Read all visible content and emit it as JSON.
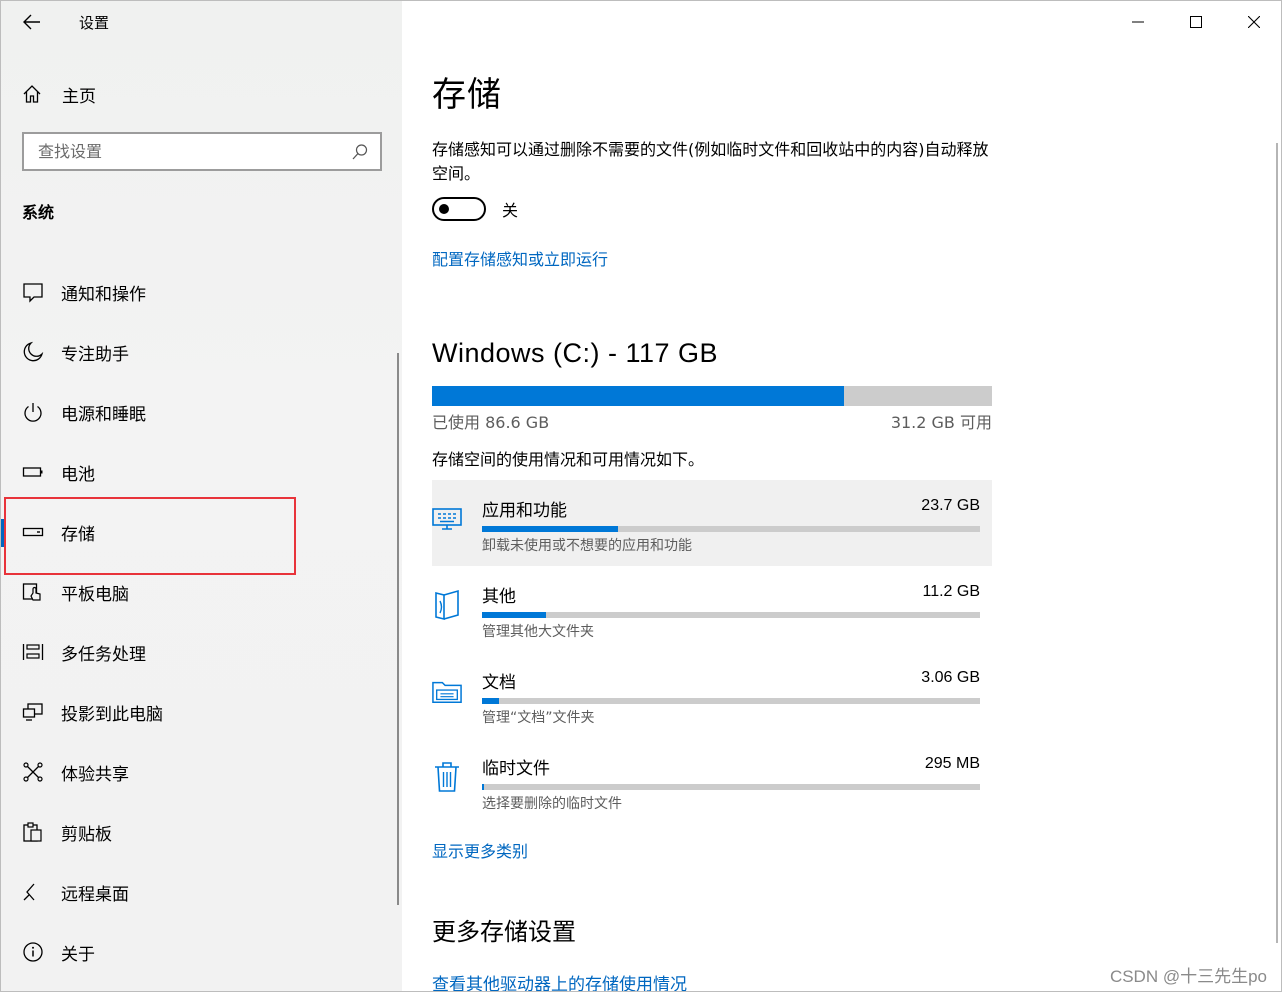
{
  "window": {
    "title": "设置"
  },
  "sidebar": {
    "home_label": "主页",
    "search_placeholder": "查找设置",
    "section": "系统",
    "items": [
      {
        "label": "通知和操作",
        "icon": "notification-icon"
      },
      {
        "label": "专注助手",
        "icon": "moon-icon"
      },
      {
        "label": "电源和睡眠",
        "icon": "power-icon"
      },
      {
        "label": "电池",
        "icon": "battery-icon"
      },
      {
        "label": "存储",
        "icon": "storage-drive-icon",
        "active": true
      },
      {
        "label": "平板电脑",
        "icon": "tablet-icon"
      },
      {
        "label": "多任务处理",
        "icon": "multitasking-icon"
      },
      {
        "label": "投影到此电脑",
        "icon": "projection-icon"
      },
      {
        "label": "体验共享",
        "icon": "share-icon"
      },
      {
        "label": "剪贴板",
        "icon": "clipboard-icon"
      },
      {
        "label": "远程桌面",
        "icon": "remote-desktop-icon"
      },
      {
        "label": "关于",
        "icon": "info-icon"
      }
    ]
  },
  "main": {
    "title": "存储",
    "description": "存储感知可以通过删除不需要的文件(例如临时文件和回收站中的内容)自动释放空间。",
    "toggle_state": "关",
    "config_link": "配置存储感知或立即运行",
    "drive": {
      "title": "Windows (C:) - 117 GB",
      "used_label": "已使用 86.6 GB",
      "free_label": "31.2 GB 可用",
      "used_fraction": 0.735
    },
    "usage_description": "存储空间的使用情况和可用情况如下。",
    "categories": [
      {
        "name": "应用和功能",
        "size": "23.7 GB",
        "desc": "卸载未使用或不想要的应用和功能",
        "fraction": 0.274,
        "icon": "apps-icon"
      },
      {
        "name": "其他",
        "size": "11.2 GB",
        "desc": "管理其他大文件夹",
        "fraction": 0.129,
        "icon": "other-files-icon"
      },
      {
        "name": "文档",
        "size": "3.06 GB",
        "desc": "管理“文档”文件夹",
        "fraction": 0.035,
        "icon": "documents-folder-icon"
      },
      {
        "name": "临时文件",
        "size": "295 MB",
        "desc": "选择要删除的临时文件",
        "fraction": 0.004,
        "icon": "trash-icon"
      }
    ],
    "more_categories_link": "显示更多类别",
    "more_settings_title": "更多存储设置",
    "other_drives_link": "查看其他驱动器上的存储使用情况"
  },
  "watermark": "CSDN @十三先生po",
  "colors": {
    "accent": "#0078d7",
    "link": "#0067c0",
    "highlight": "#e8333a"
  }
}
